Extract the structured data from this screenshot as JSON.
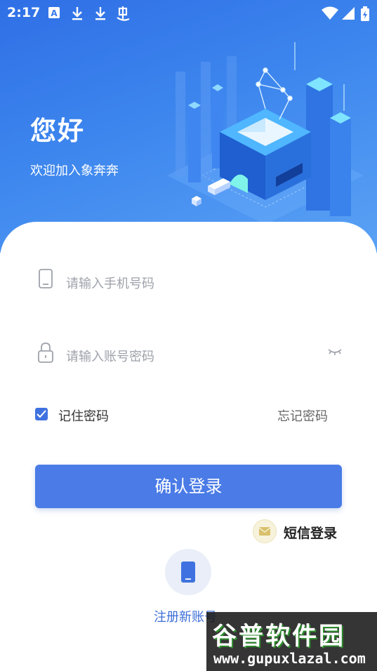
{
  "status_bar": {
    "time": "2:17",
    "left_icons": [
      "font-a-icon",
      "download-icon",
      "download-icon",
      "bug-icon"
    ],
    "right_icons": [
      "wifi-icon",
      "signal-icon",
      "battery-charging-icon"
    ]
  },
  "hero": {
    "greeting": "您好",
    "welcome": "欢迎加入象奔奔",
    "background_color_start": "#2f6fe6",
    "background_color_end": "#5aa2f4"
  },
  "form": {
    "phone": {
      "placeholder": "请输入手机号码",
      "icon": "phone-icon"
    },
    "password": {
      "placeholder": "请输入账号密码",
      "icon": "lock-icon",
      "toggle_icon": "eye-closed-icon"
    },
    "remember": {
      "label": "记住密码",
      "checked": true
    },
    "forgot_label": "忘记密码",
    "login_label": "确认登录",
    "sms_login_label": "短信登录",
    "sms_icon": "mail-icon",
    "register_label": "注册新账号",
    "register_icon": "mobile-icon",
    "accent_color": "#4a7be6"
  },
  "watermark": {
    "title": "谷普软件园",
    "url": "www.gupuxlazal.com"
  }
}
